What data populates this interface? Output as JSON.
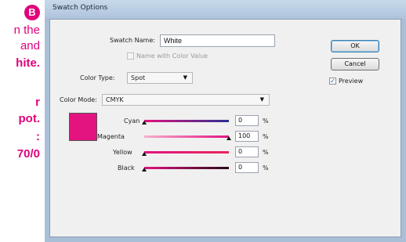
{
  "tutorial": {
    "badge": "B",
    "lines": [
      {
        "text": "n the",
        "bold": false
      },
      {
        "text": "and",
        "bold": false
      },
      {
        "text": "hite.",
        "bold": true
      },
      {
        "text": "r",
        "bold": true
      },
      {
        "text": "pot.",
        "bold": true
      },
      {
        "text": ":",
        "bold": true
      },
      {
        "text": "70/0",
        "bold": true
      }
    ]
  },
  "window": {
    "title": "Swatch Options"
  },
  "dialog": {
    "swatch_name_label": "Swatch Name:",
    "swatch_name_value": "White",
    "name_with_color_value_label": "Name with Color Value",
    "name_with_color_value_checked": false,
    "name_with_color_value_disabled": true,
    "color_type_label": "Color Type:",
    "color_type_value": "Spot",
    "color_mode_label": "Color Mode:",
    "color_mode_value": "CMYK",
    "swatch_color": "#e3137f",
    "channels": [
      {
        "label": "Cyan",
        "value": "0",
        "level": 0,
        "gradient": [
          "#e3137f",
          "#2b2f8f"
        ]
      },
      {
        "label": "Magenta",
        "value": "100",
        "level": 1,
        "gradient": [
          "#f6b0cf",
          "#e3137f"
        ]
      },
      {
        "label": "Yellow",
        "value": "0",
        "level": 0,
        "gradient": [
          "#e3137f",
          "#e8265a"
        ]
      },
      {
        "label": "Black",
        "value": "0",
        "level": 0,
        "gradient": [
          "#e3137f",
          "#2a0a18"
        ]
      }
    ],
    "percent_sign": "%",
    "ok_label": "OK",
    "cancel_label": "Cancel",
    "preview_label": "Preview",
    "preview_checked": true
  }
}
